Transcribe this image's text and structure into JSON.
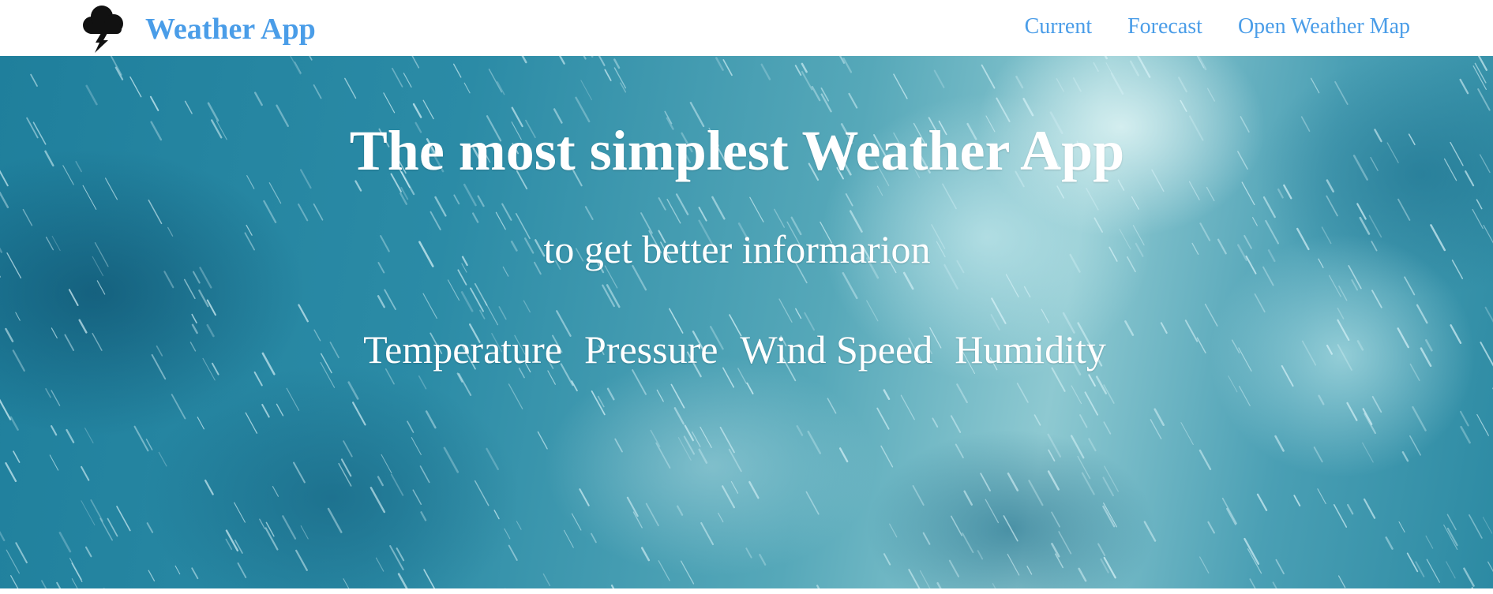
{
  "navbar": {
    "brand": {
      "title": "Weather App",
      "logo_icon": "storm-cloud-icon"
    },
    "links": [
      {
        "label": "Current"
      },
      {
        "label": "Forecast"
      },
      {
        "label": "Open Weather Map"
      }
    ],
    "link_color": "#4a9de8"
  },
  "hero": {
    "title": "The most simplest Weather App",
    "subtitle": "to get better informarion",
    "features": [
      {
        "label": "Temperature"
      },
      {
        "label": "Pressure"
      },
      {
        "label": "Wind Speed"
      },
      {
        "label": "Humidity"
      }
    ],
    "background": "rainy-sky-background",
    "text_color": "#ffffff"
  }
}
